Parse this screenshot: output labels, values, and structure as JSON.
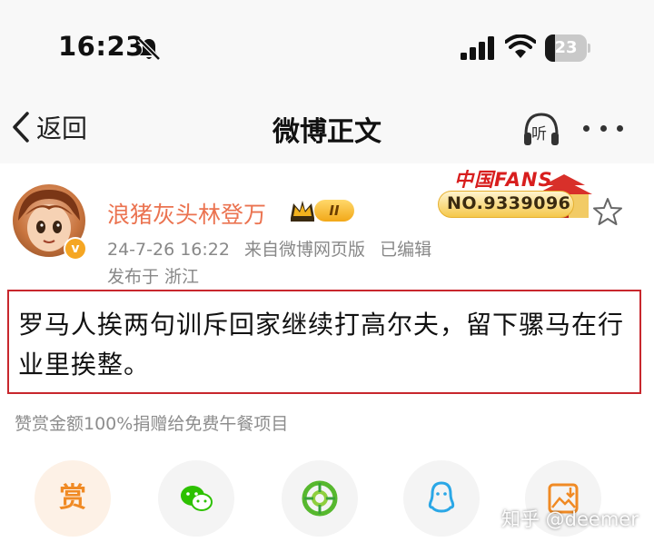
{
  "status_bar": {
    "time": "16:23",
    "battery": "23",
    "battery_level_percent": 23,
    "icons": [
      "bell-slash-icon",
      "signal-icon",
      "wifi-icon",
      "battery-icon"
    ]
  },
  "nav": {
    "back_label": "返回",
    "title": "微博正文",
    "listen_label": "听",
    "icons": [
      "chevron-left-icon",
      "headphones-icon",
      "more-icon"
    ]
  },
  "post": {
    "author": "浪猪灰头林登万",
    "member_level": "II",
    "verified_badge": "v",
    "timestamp": "24-7-26 16:22",
    "source": "来自微博网页版",
    "edited": "已编辑",
    "location": "发布于 浙江",
    "fans_badge": {
      "title": "中国FANS",
      "number": "NO.9339096"
    },
    "text": "罗马人挨两句训斥回家继续打高尔夫，留下骡马在行业里挨整。",
    "reward_note": "赞赏金额100%捐赠给免费午餐项目"
  },
  "share": {
    "reward_label": "赏",
    "items": [
      "reward-button",
      "wechat-icon",
      "moments-icon",
      "qq-icon",
      "save-image-icon"
    ]
  },
  "colors": {
    "accent": "#eb7350",
    "highlight_border": "#c8272d",
    "meta_gray": "#888888"
  },
  "watermark": "知乎 @deemer"
}
